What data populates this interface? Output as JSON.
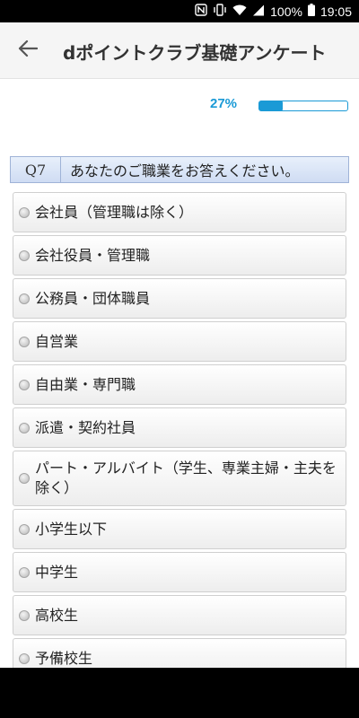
{
  "status_bar": {
    "battery": "100%",
    "time": "19:05"
  },
  "app_bar": {
    "title": "dポイントクラブ基礎アンケート"
  },
  "progress": {
    "label": "27%",
    "value": 0.27
  },
  "question": {
    "number": "Q7",
    "text": "あなたのご職業をお答えください。"
  },
  "options": [
    "会社員（管理職は除く）",
    "会社役員・管理職",
    "公務員・団体職員",
    "自営業",
    "自由業・専門職",
    "派遣・契約社員",
    "パート・アルバイト（学生、専業主婦・主夫を除く）",
    "小学生以下",
    "中学生",
    "高校生",
    "予備校生"
  ],
  "icons": {
    "back": "arrow-left-icon",
    "nfc": "nfc-icon",
    "vibrate": "vibrate-icon",
    "wifi": "wifi-icon",
    "signal": "signal-icon",
    "battery": "battery-icon"
  }
}
